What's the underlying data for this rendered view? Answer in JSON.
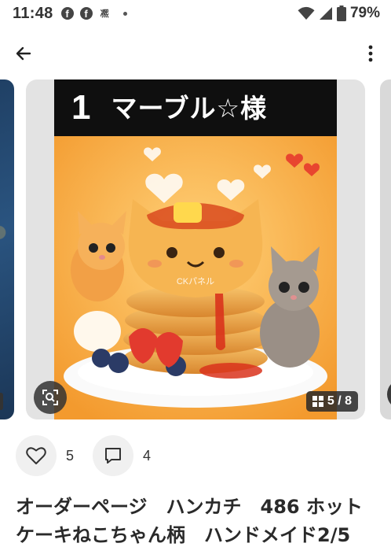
{
  "status_bar": {
    "time": "11:48",
    "battery": "79%",
    "news_glyph": "凞"
  },
  "app_bar": {
    "back_icon": "arrow-left-icon",
    "more_icon": "more-vertical-icon"
  },
  "product": {
    "banner_number": "1",
    "banner_text": "マーブル☆様",
    "watermark": "CKパネル",
    "image_counter": "5 / 8",
    "title": "オーダーページ　ハンカチ　486 ホットケーキねこちゃん柄　ハンドメイド2/5"
  },
  "reactions": {
    "likes": "5",
    "comments": "4"
  },
  "colors": {
    "banner_bg": "#0f0f0f",
    "image_bg": "#f3a23c",
    "card_bg": "#e3e3e3",
    "reaction_bg": "#f0f0f0"
  }
}
